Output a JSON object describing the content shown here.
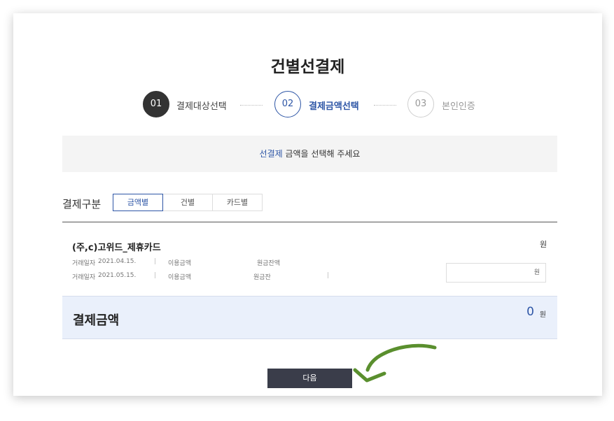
{
  "page": {
    "title": "건별선결제"
  },
  "steps": [
    {
      "num": "01",
      "label": "결제대상선택"
    },
    {
      "num": "02",
      "label": "결제금액선택"
    },
    {
      "num": "03",
      "label": "본인인증"
    }
  ],
  "notice": {
    "highlight": "선결제",
    "text": " 금액을 선택해 주세요"
  },
  "payment_type": {
    "label": "결제구분",
    "tabs": [
      "금액별",
      "건별",
      "카드별"
    ],
    "active_tab": "금액별"
  },
  "card": {
    "name": "(주,c)고위드_제휴카드",
    "won_unit": "원",
    "rows": [
      {
        "date_label": "거래일자",
        "date": "2021.04.15.",
        "usage_label": "이용금액",
        "balance_label": "원금잔액"
      },
      {
        "date_label": "거래일자",
        "date": "2021.05.15.",
        "usage_label": "이용금액",
        "balance_label": "원금잔"
      }
    ],
    "input_unit": "원"
  },
  "total": {
    "label": "결제금액",
    "value": "0",
    "unit": "원"
  },
  "actions": {
    "next_label": "다음"
  },
  "colors": {
    "accent": "#2e56a6",
    "dark": "#333333",
    "button": "#3a3d4a",
    "arrow": "#5a8f2e"
  }
}
